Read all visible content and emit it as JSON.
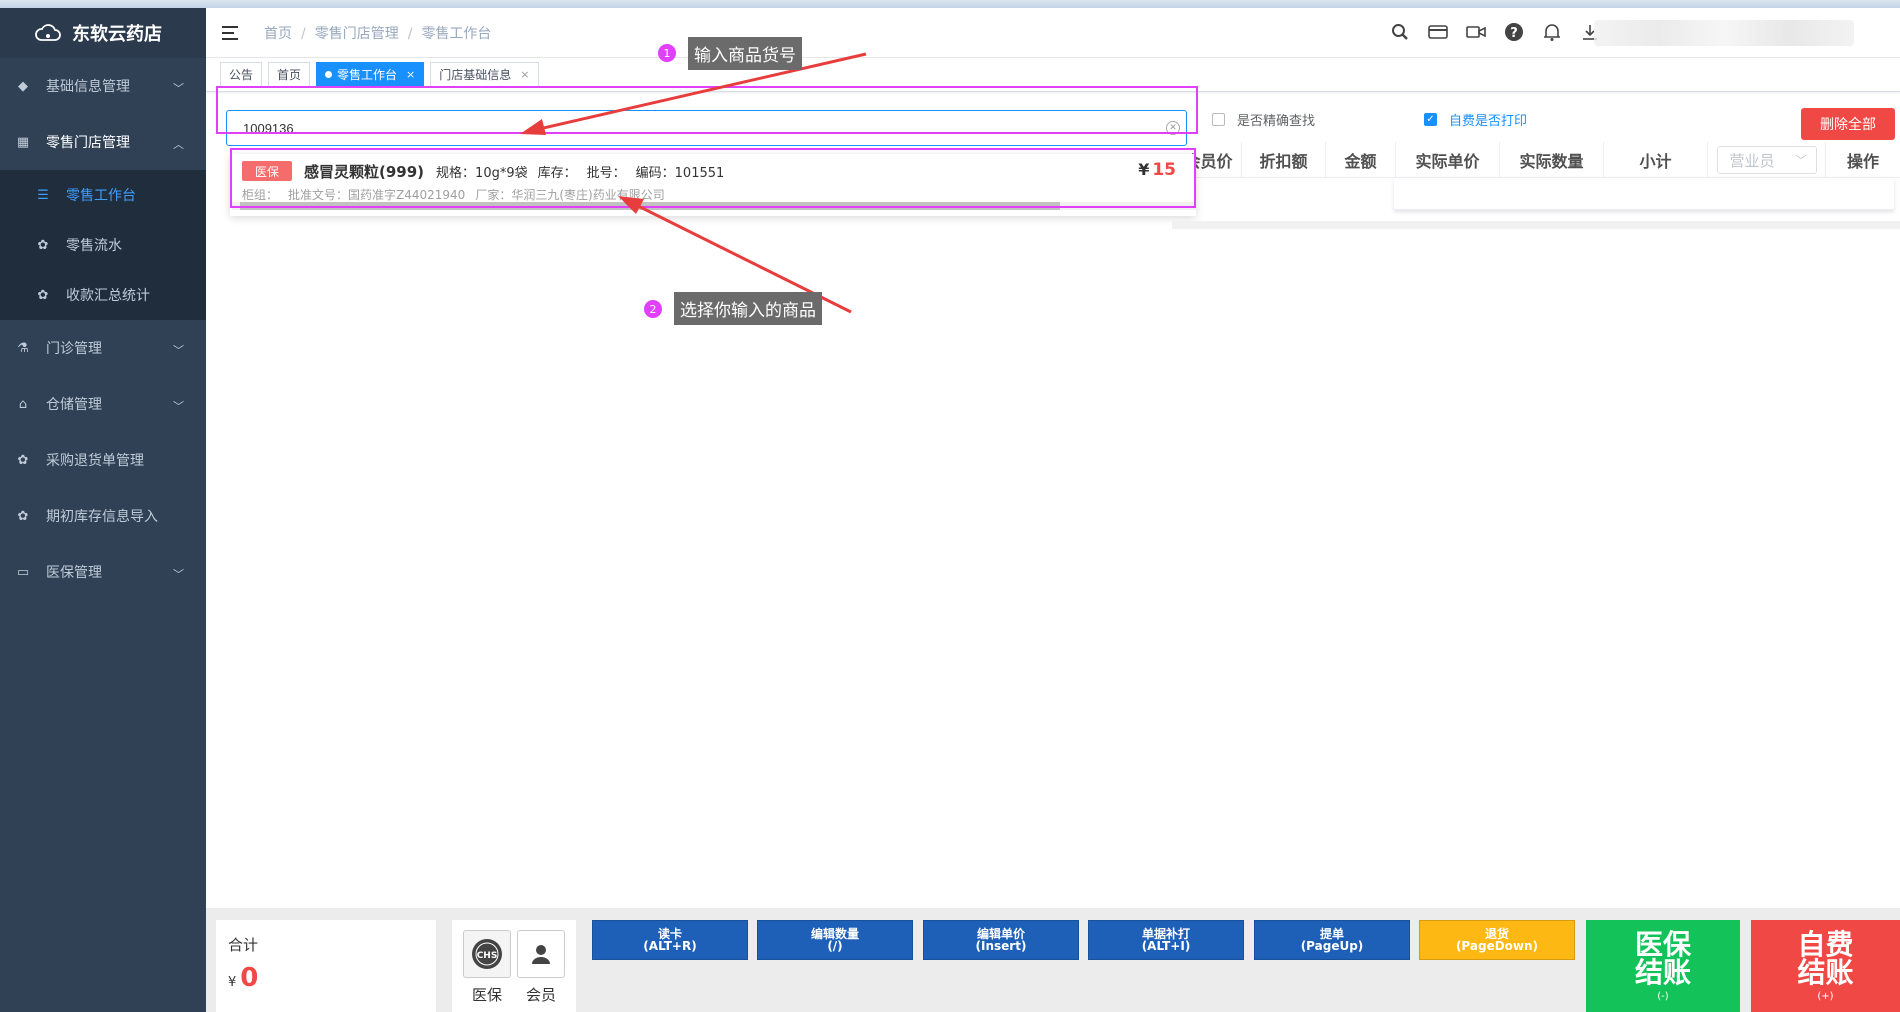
{
  "app": {
    "name": "东软云药店"
  },
  "sidebar": {
    "items": [
      {
        "label": "基础信息管理"
      },
      {
        "label": "零售门店管理"
      },
      {
        "label": "门诊管理"
      },
      {
        "label": "仓储管理"
      },
      {
        "label": "采购退货单管理"
      },
      {
        "label": "期初库存信息导入"
      },
      {
        "label": "医保管理"
      }
    ],
    "subitems": [
      {
        "label": "零售工作台"
      },
      {
        "label": "零售流水"
      },
      {
        "label": "收款汇总统计"
      }
    ]
  },
  "breadcrumb": {
    "items": [
      "首页",
      "零售门店管理",
      "零售工作台"
    ],
    "separator": "/"
  },
  "tabs": [
    {
      "label": "公告"
    },
    {
      "label": "首页"
    },
    {
      "label": "零售工作台",
      "close": "×"
    },
    {
      "label": "门店基础信息",
      "close": "×"
    }
  ],
  "search": {
    "value": "1009136"
  },
  "options": {
    "exact_search": "是否精确查找",
    "self_pay_print": "自费是否打印",
    "self_pay_print_checked": true,
    "exact_search_checked": false
  },
  "delete_all": "删除全部",
  "table": {
    "columns": [
      "会员价",
      "折扣额",
      "金额",
      "实际单价",
      "实际数量",
      "小计",
      "操作"
    ],
    "salesperson_placeholder": "营业员"
  },
  "result": {
    "badge": "医保",
    "name": "感冒灵颗粒(999)",
    "spec": "规格：10g*9袋",
    "stock": "库存：",
    "batch": "批号：",
    "code": "编码：101551",
    "currency": "¥",
    "price": "15",
    "cabinet": "柜组：",
    "approval": "批准文号：国药准字Z44021940",
    "maker": "厂家：华润三九(枣庄)药业有限公司"
  },
  "annotations": {
    "step1_num": "1",
    "step1_text": "输入商品货号",
    "step2_num": "2",
    "step2_text": "选择你输入的商品",
    "color": "#e040fb"
  },
  "footer": {
    "total_label": "合计",
    "currency": "¥",
    "total": "0",
    "pay": [
      {
        "label": "医保",
        "icon": "chs-icon"
      },
      {
        "label": "会员",
        "icon": "person-icon"
      }
    ],
    "buttons": [
      {
        "label": "读卡",
        "key": "(ALT+R)"
      },
      {
        "label": "编辑数量",
        "key": "(/)"
      },
      {
        "label": "编辑单价",
        "key": "(Insert)"
      },
      {
        "label": "单据补打",
        "key": "(ALT+I)"
      },
      {
        "label": "提单",
        "key": "(PageUp)"
      },
      {
        "label": "退货",
        "key": "(PageDown)"
      }
    ],
    "yb_checkout": {
      "label": "医保结账",
      "key": "(-)"
    },
    "self_checkout": {
      "label": "自费结账",
      "key": "(+)"
    }
  },
  "colors": {
    "sidebar": "#304156",
    "accent": "#1890ff",
    "danger": "#f04844",
    "green": "#13c35a",
    "blue": "#1e5fb8",
    "yellow": "#fdb813"
  }
}
